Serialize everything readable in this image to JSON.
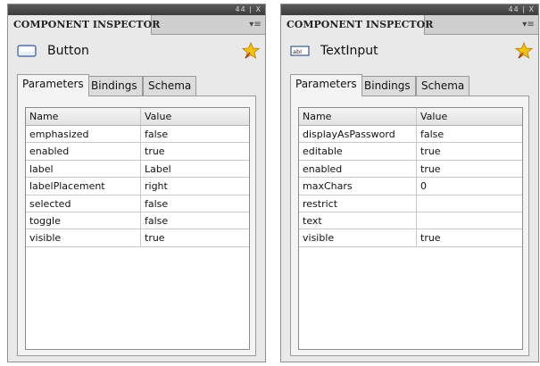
{
  "panels": [
    {
      "title": "COMPONENT INSPECTOR",
      "window_controls": "44 | X",
      "component_name": "Button",
      "component_icon": "button-icon",
      "tabs": [
        "Parameters",
        "Bindings",
        "Schema"
      ],
      "columns": [
        "Name",
        "Value"
      ],
      "rows": [
        {
          "name": "emphasized",
          "value": "false"
        },
        {
          "name": "enabled",
          "value": "true"
        },
        {
          "name": "label",
          "value": "Label"
        },
        {
          "name": "labelPlacement",
          "value": "right"
        },
        {
          "name": "selected",
          "value": "false"
        },
        {
          "name": "toggle",
          "value": "false"
        },
        {
          "name": "visible",
          "value": "true"
        }
      ]
    },
    {
      "title": "COMPONENT INSPECTOR",
      "window_controls": "44 | X",
      "component_name": "TextInput",
      "component_icon": "textinput-icon",
      "tabs": [
        "Parameters",
        "Bindings",
        "Schema"
      ],
      "columns": [
        "Name",
        "Value"
      ],
      "rows": [
        {
          "name": "displayAsPassword",
          "value": "false"
        },
        {
          "name": "editable",
          "value": "true"
        },
        {
          "name": "enabled",
          "value": "true"
        },
        {
          "name": "maxChars",
          "value": "0"
        },
        {
          "name": "restrict",
          "value": ""
        },
        {
          "name": "text",
          "value": ""
        },
        {
          "name": "visible",
          "value": "true"
        }
      ]
    }
  ]
}
